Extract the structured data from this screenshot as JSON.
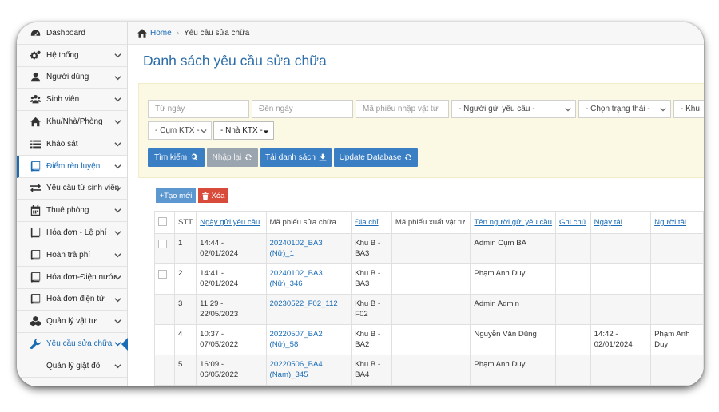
{
  "sidebar": {
    "items": [
      {
        "label": "Dashboard",
        "icon": "tachometer-icon",
        "name": "sidebar-item-dashboard",
        "chevron": false
      },
      {
        "label": "Hệ thống",
        "icon": "cogs-icon",
        "name": "sidebar-item-he-thong",
        "chevron": true
      },
      {
        "label": "Người dùng",
        "icon": "user-icon",
        "name": "sidebar-item-nguoi-dung",
        "chevron": true
      },
      {
        "label": "Sinh viên",
        "icon": "users-icon",
        "name": "sidebar-item-sinh-vien",
        "chevron": true
      },
      {
        "label": "Khu/Nhà/Phòng",
        "icon": "home-icon",
        "name": "sidebar-item-khu-nha-phong",
        "chevron": true
      },
      {
        "label": "Khảo sát",
        "icon": "list-icon",
        "name": "sidebar-item-khao-sat",
        "chevron": true
      },
      {
        "label": "Điểm rèn luyện",
        "icon": "book-icon",
        "name": "sidebar-item-diem-ren-luyen",
        "chevron": true
      },
      {
        "label": "Yêu cầu từ sinh viên",
        "icon": "exchange-icon",
        "name": "sidebar-item-yeu-cau-tu-sinh-vien",
        "chevron": true
      },
      {
        "label": "Thuê phòng",
        "icon": "calendar-icon",
        "name": "sidebar-item-thue-phong",
        "chevron": true
      },
      {
        "label": "Hóa đơn - Lệ phí",
        "icon": "book-icon",
        "name": "sidebar-item-hoa-don-le-phi",
        "chevron": true
      },
      {
        "label": "Hoàn trả phí",
        "icon": "book-icon",
        "name": "sidebar-item-hoan-tra-phi",
        "chevron": true
      },
      {
        "label": "Hóa đơn-Điện nước",
        "icon": "book-icon",
        "name": "sidebar-item-hoa-don-dien-nuoc",
        "chevron": true
      },
      {
        "label": "Hoá đơn điện tử",
        "icon": "book-icon",
        "name": "sidebar-item-hoa-don-dien-tu",
        "chevron": true
      },
      {
        "label": "Quản lý vật tư",
        "icon": "cubes-icon",
        "name": "sidebar-item-quan-ly-vat-tu",
        "chevron": true
      },
      {
        "label": "Yêu cầu sửa chữa",
        "icon": "wrench-icon",
        "name": "sidebar-item-yeu-cau-sua-chua",
        "chevron": true
      },
      {
        "label": "Quản lý giặt đồ",
        "icon": "none",
        "name": "sidebar-item-quan-ly-giat-do",
        "chevron": true
      }
    ]
  },
  "breadcrumb": {
    "home": "Home",
    "current": "Yêu cầu sửa chữa"
  },
  "page_title": "Danh sách yêu cầu sửa chữa",
  "filters": {
    "from_date_placeholder": "Từ ngày",
    "to_date_placeholder": "Đến ngày",
    "material_slip_placeholder": "Mã phiếu nhập vật tư",
    "sender_select": "- Người gửi yêu cầu -",
    "status_select": "- Chọn trạng thái -",
    "area_select": "- Khu",
    "cluster_select": "- Cụm KTX -",
    "building_select": "- Nhà KTX -"
  },
  "buttons": {
    "search": "Tìm kiếm",
    "reset": "Nhập lại",
    "download": "Tải danh sách",
    "update_db": "Update Database",
    "add": "+Tạo mới",
    "delete": "Xóa"
  },
  "table": {
    "headers": [
      "",
      "STT",
      "Ngày gửi yêu cầu",
      "Mã phiếu sửa chữa",
      "Địa chỉ",
      "Mã phiếu xuất vật tư",
      "Tên người gửi yêu cầu",
      "Ghi chú",
      "Ngày tải",
      "Người tải"
    ],
    "rows": [
      {
        "stt": "1",
        "date": "14:44 - 02/01/2024",
        "code": "20240102_BA3 (Nữ)_1",
        "address": "Khu B - BA3",
        "export": "",
        "sender": "Admin Cụm BA",
        "note": "",
        "upload_date": "",
        "uploader": "",
        "checkbox": true
      },
      {
        "stt": "2",
        "date": "14:41 - 02/01/2024",
        "code": "20240102_BA3 (Nữ)_346",
        "address": "Khu B - BA3",
        "export": "",
        "sender": "Phạm Anh Duy",
        "note": "",
        "upload_date": "",
        "uploader": "",
        "checkbox": true
      },
      {
        "stt": "3",
        "date": "11:29 - 22/05/2023",
        "code": "20230522_F02_112",
        "address": "Khu B - F02",
        "export": "",
        "sender": "Admin Admin",
        "note": "",
        "upload_date": "",
        "uploader": "",
        "checkbox": false
      },
      {
        "stt": "4",
        "date": "10:37 - 07/05/2022",
        "code": "20220507_BA2 (Nữ)_58",
        "address": "Khu B - BA2",
        "export": "",
        "sender": "Nguyễn Văn Dũng",
        "note": "",
        "upload_date": "14:42 - 02/01/2024",
        "uploader": "Phạm Anh Duy",
        "checkbox": false
      },
      {
        "stt": "5",
        "date": "16:09 - 06/05/2022",
        "code": "20220506_BA4 (Nam)_345",
        "address": "Khu B - BA4",
        "export": "",
        "sender": "Phạm Anh Duy",
        "note": "",
        "upload_date": "",
        "uploader": "",
        "checkbox": false
      }
    ]
  },
  "colors": {
    "accent": "#1a6cb6",
    "filter_bg": "#fbf8e3",
    "primary_button": "#3a7ec4",
    "danger_button": "#d84a3a"
  }
}
